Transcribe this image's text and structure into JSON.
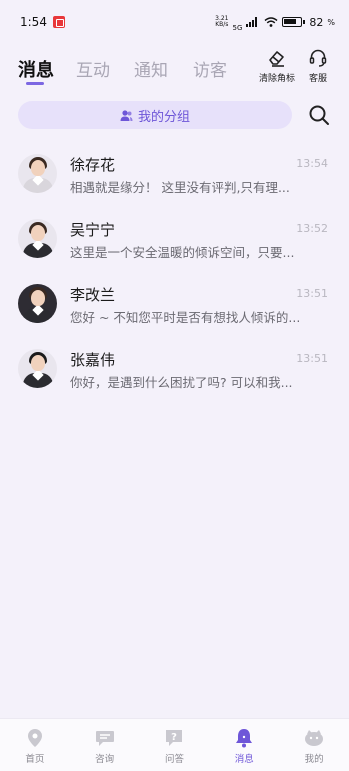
{
  "status": {
    "time": "1:54",
    "net_speed_top": "3.21",
    "net_speed_bottom": "KB/s",
    "network": "5G",
    "battery": "82"
  },
  "tabs": [
    {
      "label": "消息",
      "active": true
    },
    {
      "label": "互动",
      "active": false
    },
    {
      "label": "通知",
      "active": false
    },
    {
      "label": "访客",
      "active": false
    }
  ],
  "header_actions": {
    "clear_badge": "清除角标",
    "service": "客服"
  },
  "group": {
    "label": "我的分组"
  },
  "chats": [
    {
      "name": "徐存花",
      "time": "13:54",
      "preview": "相遇就是缘分！ 这里没有评判,只有理..."
    },
    {
      "name": "吴宁宁",
      "time": "13:52",
      "preview": "这里是一个安全温暖的倾诉空间，只要..."
    },
    {
      "name": "李改兰",
      "time": "13:51",
      "preview": "您好 ~ 不知您平时是否有想找人倾诉的..."
    },
    {
      "name": "张嘉伟",
      "time": "13:51",
      "preview": "你好，是遇到什么困扰了吗? 可以和我..."
    }
  ],
  "bottom_nav": [
    {
      "label": "首页",
      "icon": "location-pin-icon"
    },
    {
      "label": "咨询",
      "icon": "chat-bubble-icon"
    },
    {
      "label": "问答",
      "icon": "question-icon"
    },
    {
      "label": "消息",
      "icon": "bell-icon",
      "active": true
    },
    {
      "label": "我的",
      "icon": "face-icon"
    }
  ],
  "colors": {
    "accent": "#6e56d8",
    "background": "#f4f1fa"
  }
}
